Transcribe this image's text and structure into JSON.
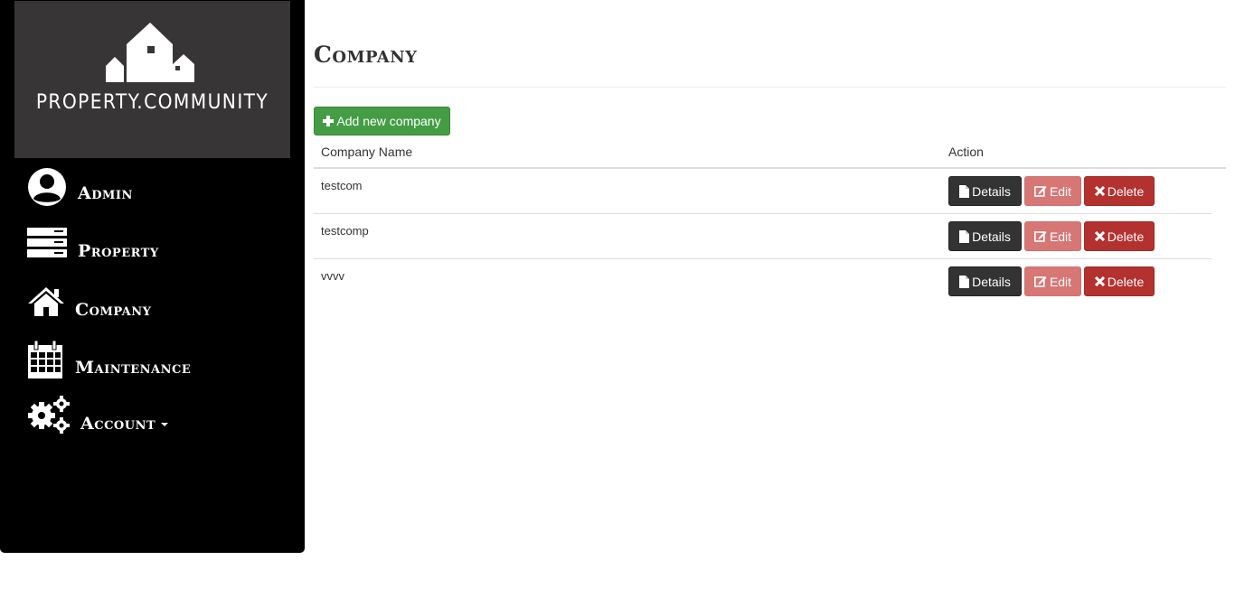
{
  "brand": {
    "name": "PROPERTY.COMMUNITY"
  },
  "sidebar": {
    "items": [
      {
        "label": "Admin",
        "icon": "user-circle-icon"
      },
      {
        "label": "Property",
        "icon": "server-icon"
      },
      {
        "label": "Company",
        "icon": "home-icon"
      },
      {
        "label": "Maintenance",
        "icon": "calendar-icon"
      },
      {
        "label": "Account",
        "icon": "gears-icon"
      }
    ]
  },
  "page": {
    "title": "Company"
  },
  "toolbar": {
    "add_label": "Add new company"
  },
  "table": {
    "headers": [
      "Company Name",
      "Action"
    ],
    "rows": [
      {
        "name": "testcom"
      },
      {
        "name": "testcomp"
      },
      {
        "name": "vvvv"
      }
    ],
    "actions": {
      "details": "Details",
      "edit": "Edit",
      "delete": "Delete"
    }
  },
  "colors": {
    "sidebar": "#000000",
    "logo_bg": "#373535",
    "add": "#449d44",
    "details": "#333333",
    "edit": "#d67675",
    "delete": "#b3312e"
  }
}
